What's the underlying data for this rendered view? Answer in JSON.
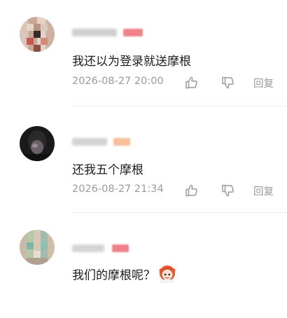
{
  "comments": [
    {
      "text": "我还以为登录就送摩根",
      "time": "2026-08-27 20:00",
      "reply_label": "回复"
    },
    {
      "text": "还我五个摩根",
      "time": "2026-08-27 21:34",
      "reply_label": "回复"
    },
    {
      "text": "我们的摩根呢？"
    }
  ],
  "icons": {
    "like": "thumbs-up-icon",
    "dislike": "thumbs-down-icon",
    "emoji": "anime-girl-emoji-icon"
  },
  "colors": {
    "text": "#1c1c1c",
    "meta": "#9a9a9a",
    "badge_red": "#f0808a",
    "badge_orange": "#f7c09a"
  }
}
